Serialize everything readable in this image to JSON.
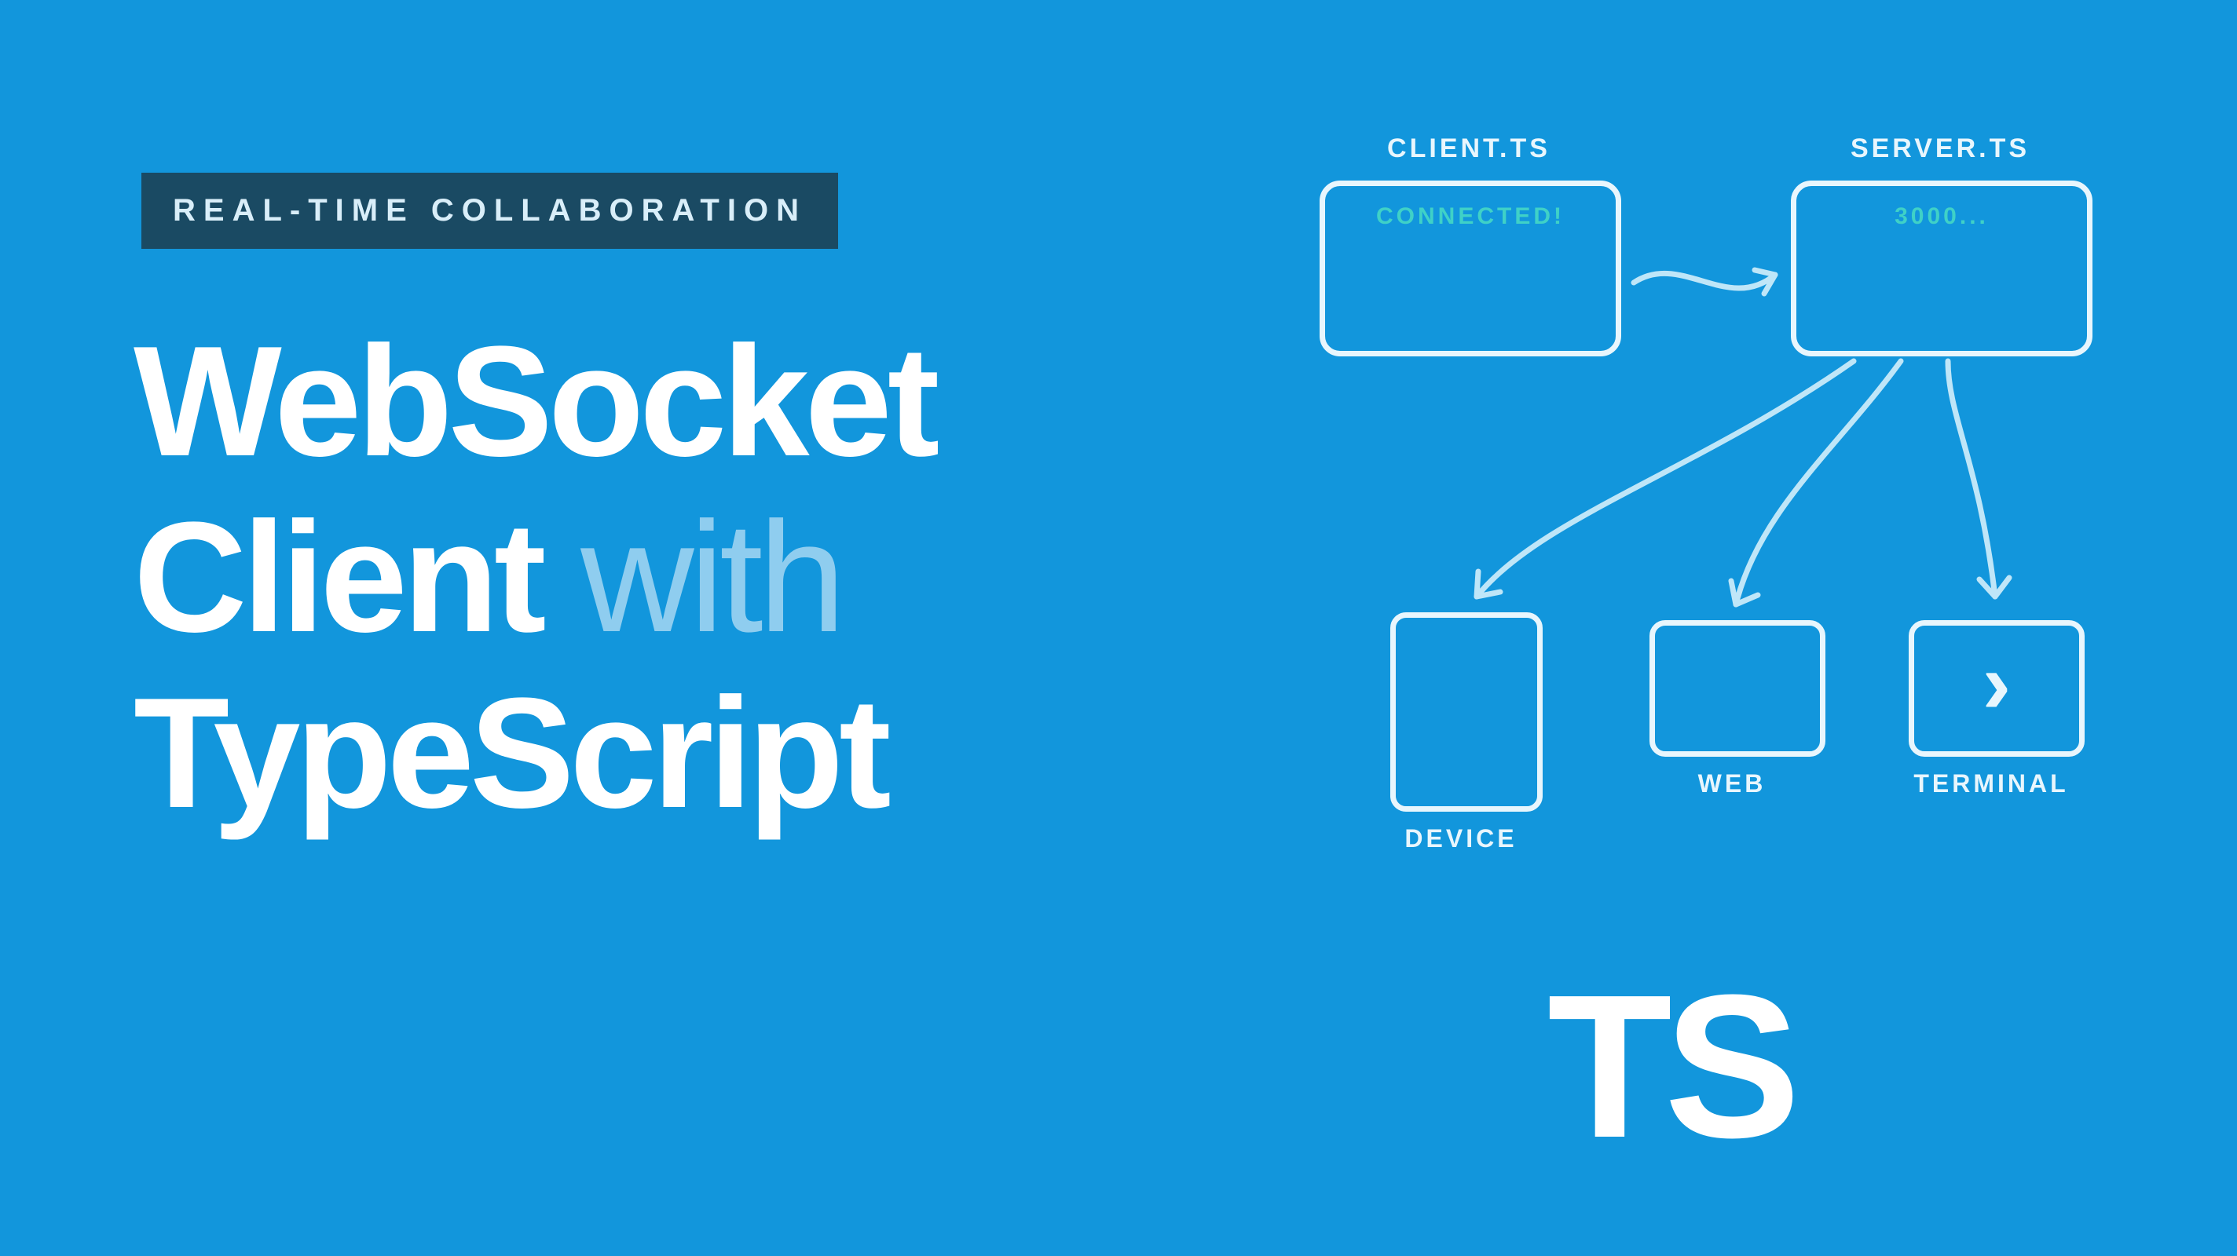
{
  "badge": "REAL-TIME COLLABORATION",
  "title_line1": "WebSocket",
  "title_line2a": "Client ",
  "title_line2b": "with",
  "title_line3": "TypeScript",
  "diagram": {
    "client_label": "CLIENT.TS",
    "server_label": "SERVER.TS",
    "client_status": "CONNECTED!",
    "server_status": "3000...",
    "device_label": "DEVICE",
    "web_label": "WEB",
    "terminal_label": "TERMINAL",
    "terminal_glyph": "›"
  },
  "logo": "TS"
}
